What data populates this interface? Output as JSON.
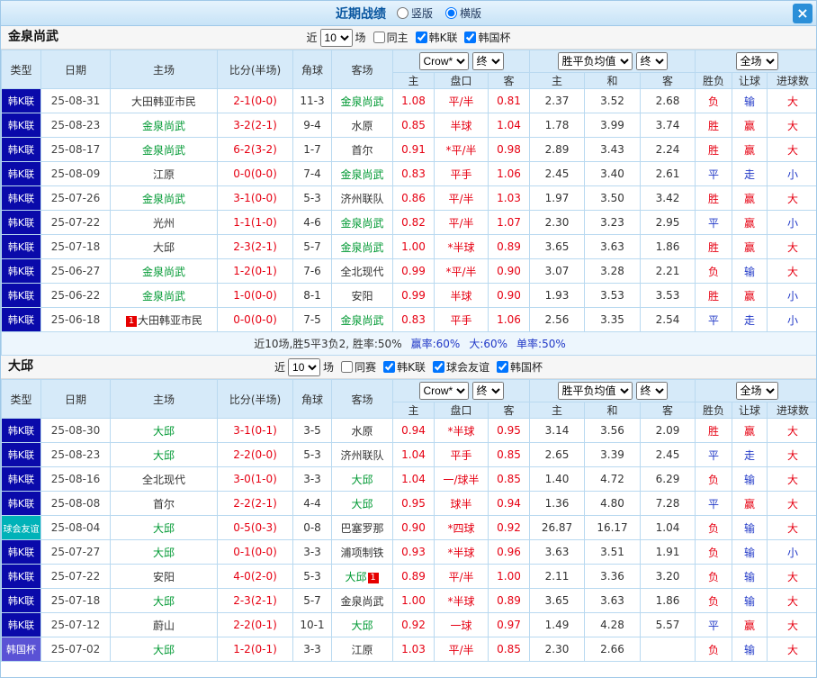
{
  "topbar": {
    "title": "近期战绩",
    "view_options": [
      {
        "label": "竖版",
        "selected": false
      },
      {
        "label": "横版",
        "selected": true
      }
    ],
    "close_label": "×"
  },
  "filters_labels": {
    "near": "近",
    "matches": "场"
  },
  "table_header": {
    "left_cols": [
      "类型",
      "日期",
      "主场",
      "比分(半场)",
      "角球",
      "客场"
    ],
    "odds_select": "Crow*",
    "odds_final_select": "终",
    "odds_cols": [
      "主",
      "盘口",
      "客"
    ],
    "mean_select": "胜平负均值",
    "mean_final_select": "终",
    "mean_cols": [
      "主",
      "和",
      "客"
    ],
    "scope_select": "全场",
    "result_cols": [
      "胜负",
      "让球",
      "进球数"
    ]
  },
  "colors": {
    "league_bg": {
      "韩K联": "#0a0aaa",
      "球会友谊": "#00b2b8",
      "韩国杯": "#5a52d5"
    },
    "result_text": {
      "胜": "#e60012",
      "平": "#2038c7",
      "负": "#e60012",
      "赢": "#e60012",
      "走": "#2038c7",
      "输": "#2038c7",
      "大": "#e60012",
      "小": "#2038c7"
    },
    "focus_team": "#009933",
    "score": "#e60012",
    "odds": "#e60012"
  },
  "sections": [
    {
      "team": "金泉尚武",
      "near_value": "10",
      "checkboxes": [
        {
          "label": "同主",
          "checked": false
        },
        {
          "label": "韩K联",
          "checked": true
        },
        {
          "label": "韩国杯",
          "checked": true
        }
      ],
      "rows": [
        {
          "league": "韩K联",
          "date": "25-08-31",
          "home": {
            "name": "大田韩亚市民",
            "focus": false
          },
          "score": "2-1(0-0)",
          "corner": "11-3",
          "away": {
            "name": "金泉尚武",
            "focus": true
          },
          "odds": [
            "1.08",
            "平/半",
            "0.81"
          ],
          "mean": [
            "2.37",
            "3.52",
            "2.68"
          ],
          "result": [
            "负",
            "输",
            "大"
          ]
        },
        {
          "league": "韩K联",
          "date": "25-08-23",
          "home": {
            "name": "金泉尚武",
            "focus": true
          },
          "score": "3-2(2-1)",
          "corner": "9-4",
          "away": {
            "name": "水原",
            "focus": false
          },
          "odds": [
            "0.85",
            "半球",
            "1.04"
          ],
          "mean": [
            "1.78",
            "3.99",
            "3.74"
          ],
          "result": [
            "胜",
            "赢",
            "大"
          ]
        },
        {
          "league": "韩K联",
          "date": "25-08-17",
          "home": {
            "name": "金泉尚武",
            "focus": true
          },
          "score": "6-2(3-2)",
          "corner": "1-7",
          "away": {
            "name": "首尔",
            "focus": false
          },
          "odds": [
            "0.91",
            "*平/半",
            "0.98"
          ],
          "mean": [
            "2.89",
            "3.43",
            "2.24"
          ],
          "result": [
            "胜",
            "赢",
            "大"
          ]
        },
        {
          "league": "韩K联",
          "date": "25-08-09",
          "home": {
            "name": "江原",
            "focus": false
          },
          "score": "0-0(0-0)",
          "corner": "7-4",
          "away": {
            "name": "金泉尚武",
            "focus": true
          },
          "odds": [
            "0.83",
            "平手",
            "1.06"
          ],
          "mean": [
            "2.45",
            "3.40",
            "2.61"
          ],
          "result": [
            "平",
            "走",
            "小"
          ]
        },
        {
          "league": "韩K联",
          "date": "25-07-26",
          "home": {
            "name": "金泉尚武",
            "focus": true
          },
          "score": "3-1(0-0)",
          "corner": "5-3",
          "away": {
            "name": "济州联队",
            "focus": false
          },
          "odds": [
            "0.86",
            "平/半",
            "1.03"
          ],
          "mean": [
            "1.97",
            "3.50",
            "3.42"
          ],
          "result": [
            "胜",
            "赢",
            "大"
          ]
        },
        {
          "league": "韩K联",
          "date": "25-07-22",
          "home": {
            "name": "光州",
            "focus": false
          },
          "score": "1-1(1-0)",
          "corner": "4-6",
          "away": {
            "name": "金泉尚武",
            "focus": true
          },
          "odds": [
            "0.82",
            "平/半",
            "1.07"
          ],
          "mean": [
            "2.30",
            "3.23",
            "2.95"
          ],
          "result": [
            "平",
            "赢",
            "小"
          ]
        },
        {
          "league": "韩K联",
          "date": "25-07-18",
          "home": {
            "name": "大邱",
            "focus": false
          },
          "score": "2-3(2-1)",
          "corner": "5-7",
          "away": {
            "name": "金泉尚武",
            "focus": true
          },
          "odds": [
            "1.00",
            "*半球",
            "0.89"
          ],
          "mean": [
            "3.65",
            "3.63",
            "1.86"
          ],
          "result": [
            "胜",
            "赢",
            "大"
          ]
        },
        {
          "league": "韩K联",
          "date": "25-06-27",
          "home": {
            "name": "金泉尚武",
            "focus": true
          },
          "score": "1-2(0-1)",
          "corner": "7-6",
          "away": {
            "name": "全北现代",
            "focus": false
          },
          "odds": [
            "0.99",
            "*平/半",
            "0.90"
          ],
          "mean": [
            "3.07",
            "3.28",
            "2.21"
          ],
          "result": [
            "负",
            "输",
            "大"
          ]
        },
        {
          "league": "韩K联",
          "date": "25-06-22",
          "home": {
            "name": "金泉尚武",
            "focus": true
          },
          "score": "1-0(0-0)",
          "corner": "8-1",
          "away": {
            "name": "安阳",
            "focus": false
          },
          "odds": [
            "0.99",
            "半球",
            "0.90"
          ],
          "mean": [
            "1.93",
            "3.53",
            "3.53"
          ],
          "result": [
            "胜",
            "赢",
            "小"
          ]
        },
        {
          "league": "韩K联",
          "date": "25-06-18",
          "home": {
            "name": "大田韩亚市民",
            "focus": false,
            "badge": "1",
            "badge_pos": "before"
          },
          "score": "0-0(0-0)",
          "corner": "7-5",
          "away": {
            "name": "金泉尚武",
            "focus": true
          },
          "odds": [
            "0.83",
            "平手",
            "1.06"
          ],
          "mean": [
            "2.56",
            "3.35",
            "2.54"
          ],
          "result": [
            "平",
            "走",
            "小"
          ]
        }
      ],
      "summary": [
        {
          "text": "近10场,胜5平3负2, 胜率:50%",
          "color": "#333333"
        },
        {
          "text": "赢率:60%",
          "color": "#2038c7"
        },
        {
          "text": "大:60%",
          "color": "#2038c7"
        },
        {
          "text": "单率:50%",
          "color": "#2038c7"
        }
      ]
    },
    {
      "team": "大邱",
      "near_value": "10",
      "checkboxes": [
        {
          "label": "同赛",
          "checked": false
        },
        {
          "label": "韩K联",
          "checked": true
        },
        {
          "label": "球会友谊",
          "checked": true
        },
        {
          "label": "韩国杯",
          "checked": true
        }
      ],
      "rows": [
        {
          "league": "韩K联",
          "date": "25-08-30",
          "home": {
            "name": "大邱",
            "focus": true
          },
          "score": "3-1(0-1)",
          "corner": "3-5",
          "away": {
            "name": "水原",
            "focus": false
          },
          "odds": [
            "0.94",
            "*半球",
            "0.95"
          ],
          "mean": [
            "3.14",
            "3.56",
            "2.09"
          ],
          "result": [
            "胜",
            "赢",
            "大"
          ]
        },
        {
          "league": "韩K联",
          "date": "25-08-23",
          "home": {
            "name": "大邱",
            "focus": true
          },
          "score": "2-2(0-0)",
          "corner": "5-3",
          "away": {
            "name": "济州联队",
            "focus": false
          },
          "odds": [
            "1.04",
            "平手",
            "0.85"
          ],
          "mean": [
            "2.65",
            "3.39",
            "2.45"
          ],
          "result": [
            "平",
            "走",
            "大"
          ]
        },
        {
          "league": "韩K联",
          "date": "25-08-16",
          "home": {
            "name": "全北现代",
            "focus": false
          },
          "score": "3-0(1-0)",
          "corner": "3-3",
          "away": {
            "name": "大邱",
            "focus": true
          },
          "odds": [
            "1.04",
            "一/球半",
            "0.85"
          ],
          "mean": [
            "1.40",
            "4.72",
            "6.29"
          ],
          "result": [
            "负",
            "输",
            "大"
          ]
        },
        {
          "league": "韩K联",
          "date": "25-08-08",
          "home": {
            "name": "首尔",
            "focus": false
          },
          "score": "2-2(2-1)",
          "corner": "4-4",
          "away": {
            "name": "大邱",
            "focus": true
          },
          "odds": [
            "0.95",
            "球半",
            "0.94"
          ],
          "mean": [
            "1.36",
            "4.80",
            "7.28"
          ],
          "result": [
            "平",
            "赢",
            "大"
          ]
        },
        {
          "league": "球会友谊",
          "date": "25-08-04",
          "home": {
            "name": "大邱",
            "focus": true
          },
          "score": "0-5(0-3)",
          "corner": "0-8",
          "away": {
            "name": "巴塞罗那",
            "focus": false
          },
          "odds": [
            "0.90",
            "*四球",
            "0.92"
          ],
          "mean": [
            "26.87",
            "16.17",
            "1.04"
          ],
          "result": [
            "负",
            "输",
            "大"
          ]
        },
        {
          "league": "韩K联",
          "date": "25-07-27",
          "home": {
            "name": "大邱",
            "focus": true
          },
          "score": "0-1(0-0)",
          "corner": "3-3",
          "away": {
            "name": "浦项制铁",
            "focus": false
          },
          "odds": [
            "0.93",
            "*半球",
            "0.96"
          ],
          "mean": [
            "3.63",
            "3.51",
            "1.91"
          ],
          "result": [
            "负",
            "输",
            "小"
          ]
        },
        {
          "league": "韩K联",
          "date": "25-07-22",
          "home": {
            "name": "安阳",
            "focus": false
          },
          "score": "4-0(2-0)",
          "corner": "5-3",
          "away": {
            "name": "大邱",
            "focus": true,
            "badge": "1",
            "badge_pos": "after"
          },
          "odds": [
            "0.89",
            "平/半",
            "1.00"
          ],
          "mean": [
            "2.11",
            "3.36",
            "3.20"
          ],
          "result": [
            "负",
            "输",
            "大"
          ]
        },
        {
          "league": "韩K联",
          "date": "25-07-18",
          "home": {
            "name": "大邱",
            "focus": true
          },
          "score": "2-3(2-1)",
          "corner": "5-7",
          "away": {
            "name": "金泉尚武",
            "focus": false
          },
          "odds": [
            "1.00",
            "*半球",
            "0.89"
          ],
          "mean": [
            "3.65",
            "3.63",
            "1.86"
          ],
          "result": [
            "负",
            "输",
            "大"
          ]
        },
        {
          "league": "韩K联",
          "date": "25-07-12",
          "home": {
            "name": "蔚山",
            "focus": false
          },
          "score": "2-2(0-1)",
          "corner": "10-1",
          "away": {
            "name": "大邱",
            "focus": true
          },
          "odds": [
            "0.92",
            "一球",
            "0.97"
          ],
          "mean": [
            "1.49",
            "4.28",
            "5.57"
          ],
          "result": [
            "平",
            "赢",
            "大"
          ]
        },
        {
          "league": "韩国杯",
          "date": "25-07-02",
          "home": {
            "name": "大邱",
            "focus": true
          },
          "score": "1-2(0-1)",
          "corner": "3-3",
          "away": {
            "name": "江原",
            "focus": false
          },
          "odds": [
            "1.03",
            "平/半",
            "0.85"
          ],
          "mean": [
            "2.30",
            "2.66",
            ""
          ],
          "result": [
            "负",
            "输",
            "大"
          ]
        }
      ],
      "summary": null
    }
  ]
}
